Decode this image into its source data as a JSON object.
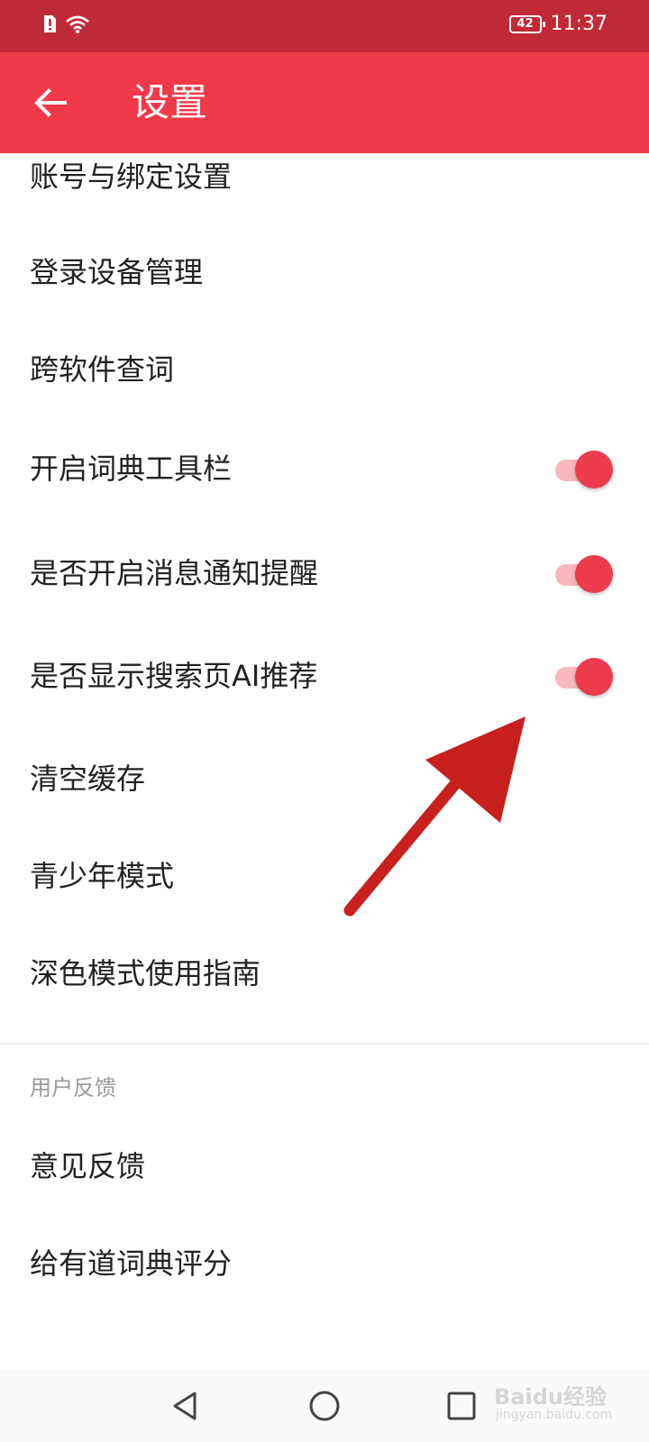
{
  "status_bar": {
    "battery": "42",
    "time": "11:37",
    "icons": [
      "alert-icon",
      "wifi-icon"
    ]
  },
  "header": {
    "title": "设置",
    "back_icon": "arrow-left-icon"
  },
  "settings": {
    "items": [
      {
        "label": "账号与绑定设置"
      },
      {
        "label": "登录设备管理"
      },
      {
        "label": "跨软件查词"
      },
      {
        "label": "开启词典工具栏",
        "toggle": true
      },
      {
        "label": "是否开启消息通知提醒",
        "toggle": true
      },
      {
        "label": "是否显示搜索页AI推荐",
        "toggle": true
      },
      {
        "label": "清空缓存"
      },
      {
        "label": "青少年模式"
      },
      {
        "label": "深色模式使用指南"
      }
    ]
  },
  "feedback": {
    "section_title": "用户反馈",
    "items": [
      {
        "label": "意见反馈"
      },
      {
        "label": "给有道词典评分"
      }
    ]
  },
  "nav_bar": {
    "icons": [
      "back-triangle-icon",
      "home-circle-icon",
      "recents-square-icon"
    ]
  },
  "watermark": {
    "brand": "Baidu经验",
    "url": "jingyan.baidu.com"
  },
  "colors": {
    "status_bar": "#c02a38",
    "app_bar": "#f03a4a",
    "toggle_on": "#eb3b4c",
    "annotation_arrow": "#c8201d"
  }
}
